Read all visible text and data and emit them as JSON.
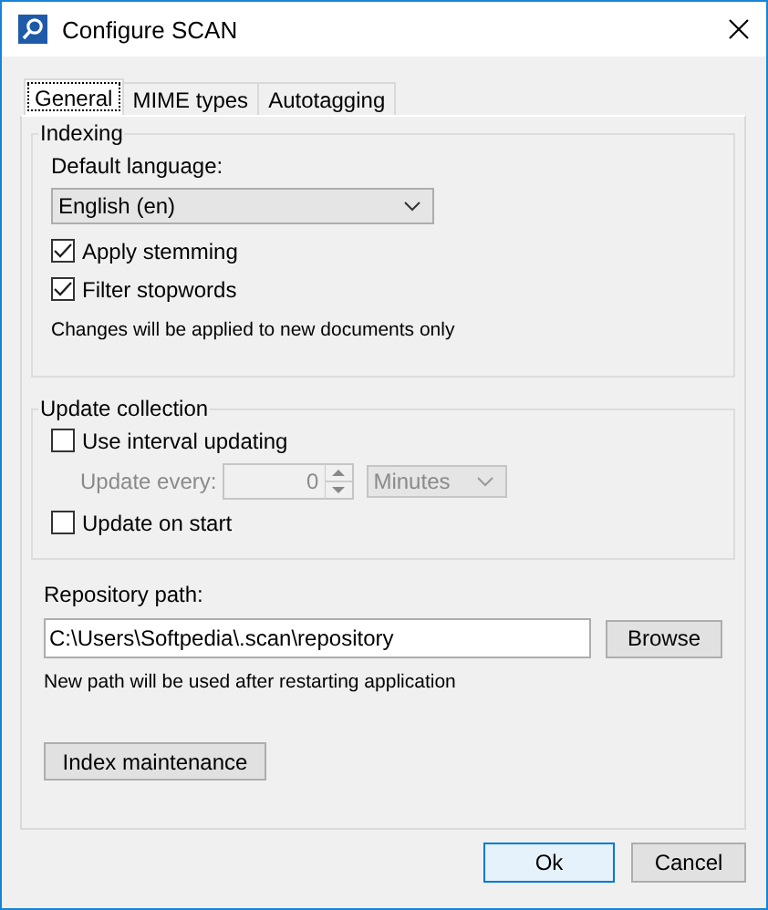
{
  "window": {
    "title": "Configure SCAN"
  },
  "tabs": [
    {
      "label": "General",
      "selected": true
    },
    {
      "label": "MIME types",
      "selected": false
    },
    {
      "label": "Autotagging",
      "selected": false
    }
  ],
  "indexing": {
    "title": "Indexing",
    "language_label": "Default language:",
    "language_value": "English (en)",
    "checkboxes": [
      {
        "label": "Apply stemming",
        "checked": true
      },
      {
        "label": "Filter stopwords",
        "checked": true
      }
    ],
    "note": "Changes will be applied to new documents only"
  },
  "update_collection": {
    "title": "Update collection",
    "use_interval": {
      "label": "Use interval updating",
      "checked": false
    },
    "interval": {
      "label": "Update every:",
      "value": "0",
      "unit": "Minutes",
      "disabled": true
    },
    "update_on_start": {
      "label": "Update on start",
      "checked": false
    }
  },
  "repository": {
    "label": "Repository path:",
    "value": "C:\\Users\\Softpedia\\.scan\\repository",
    "browse": "Browse",
    "note": "New path will be used after restarting application"
  },
  "maintenance_button": "Index maintenance",
  "buttons": [
    {
      "label": "Ok",
      "default": true
    },
    {
      "label": "Cancel",
      "default": false
    }
  ]
}
